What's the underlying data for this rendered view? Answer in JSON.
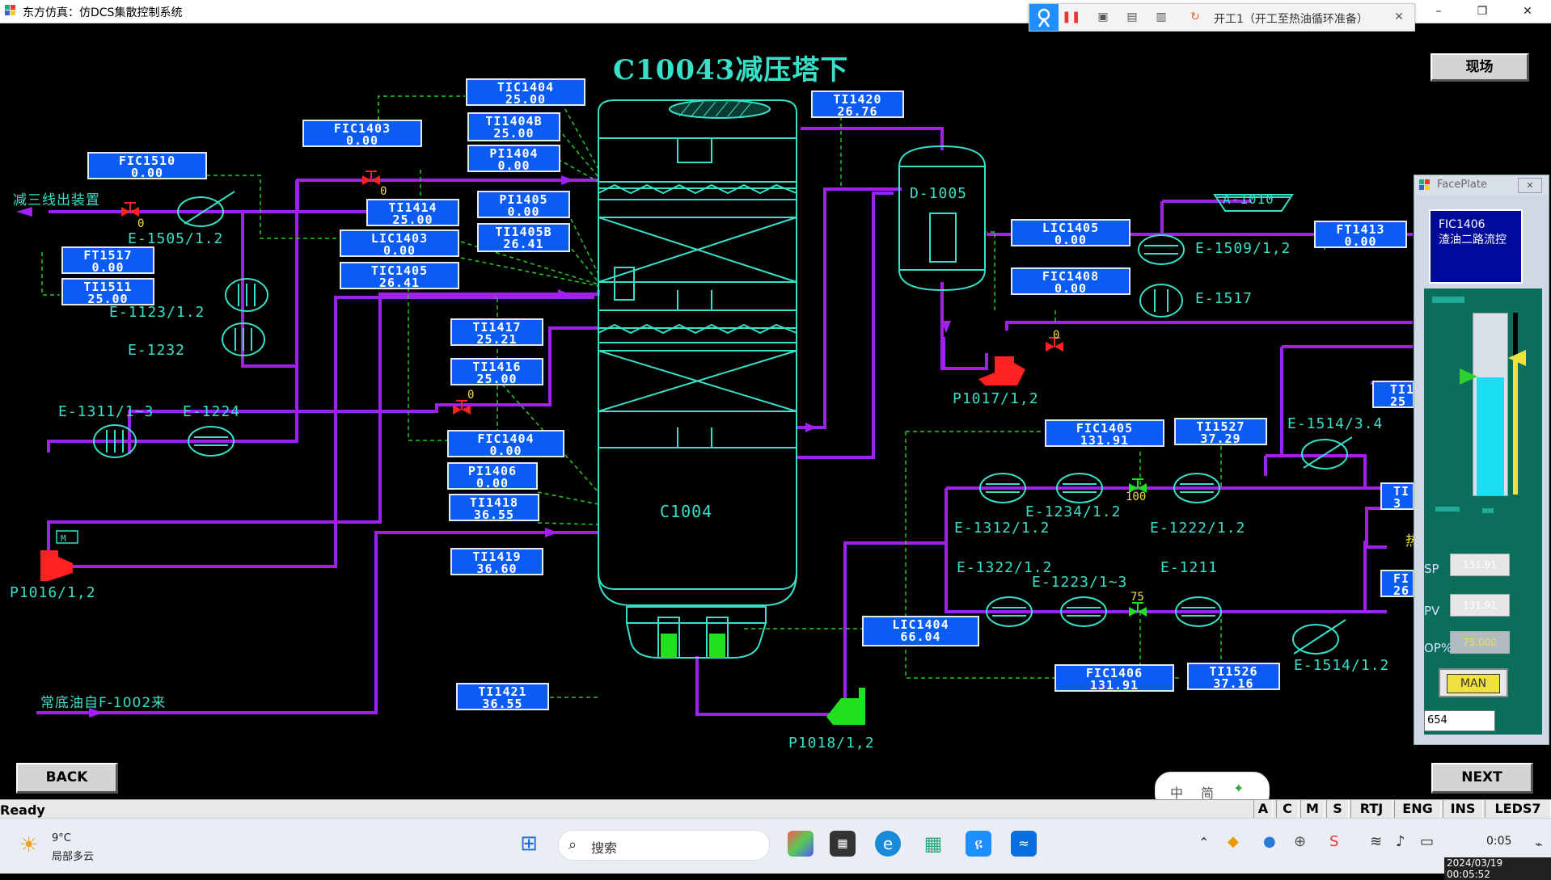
{
  "window": {
    "title": "东方仿真：仿DCS集散控制系统",
    "minimize": "–",
    "restore": "❐",
    "close": "✕"
  },
  "recorder": {
    "label": "开工1（开工至热油循环准备）",
    "close": "✕"
  },
  "screen": {
    "title": "C10043减压塔下",
    "field_button": "现场",
    "back_button": "BACK",
    "next_button": "NEXT"
  },
  "tags": [
    {
      "id": "TIC1404",
      "name": "TIC1404",
      "value": "25.00"
    },
    {
      "id": "TI1404B",
      "name": "TI1404B",
      "value": "25.00"
    },
    {
      "id": "PI1404",
      "name": "PI1404",
      "value": "0.00"
    },
    {
      "id": "TI1420",
      "name": "TI1420",
      "value": "26.76"
    },
    {
      "id": "FIC1403",
      "name": "FIC1403",
      "value": "0.00"
    },
    {
      "id": "FIC1510",
      "name": "FIC1510",
      "value": "0.00"
    },
    {
      "id": "TI1414",
      "name": "TI1414",
      "value": "25.00"
    },
    {
      "id": "PI1405",
      "name": "PI1405",
      "value": "0.00"
    },
    {
      "id": "LIC1403",
      "name": "LIC1403",
      "value": "0.00"
    },
    {
      "id": "TI1405B",
      "name": "TI1405B",
      "value": "26.41"
    },
    {
      "id": "TIC1405",
      "name": "TIC1405",
      "value": "26.41"
    },
    {
      "id": "FT1517",
      "name": "FT1517",
      "value": "0.00"
    },
    {
      "id": "TI1511",
      "name": "TI1511",
      "value": "25.00"
    },
    {
      "id": "TI1417",
      "name": "TI1417",
      "value": "25.21"
    },
    {
      "id": "TI1416",
      "name": "TI1416",
      "value": "25.00"
    },
    {
      "id": "FIC1404",
      "name": "FIC1404",
      "value": "0.00"
    },
    {
      "id": "PI1406",
      "name": "PI1406",
      "value": "0.00"
    },
    {
      "id": "TI1418",
      "name": "TI1418",
      "value": "36.55"
    },
    {
      "id": "TI1419",
      "name": "TI1419",
      "value": "36.60"
    },
    {
      "id": "TI1421",
      "name": "TI1421",
      "value": "36.55"
    },
    {
      "id": "LIC1405",
      "name": "LIC1405",
      "value": "0.00"
    },
    {
      "id": "FIC1408",
      "name": "FIC1408",
      "value": "0.00"
    },
    {
      "id": "FT1413",
      "name": "FT1413",
      "value": "0.00"
    },
    {
      "id": "FIC1405",
      "name": "FIC1405",
      "value": "131.91"
    },
    {
      "id": "TI1527",
      "name": "TI1527",
      "value": "37.29"
    },
    {
      "id": "LIC1404",
      "name": "LIC1404",
      "value": "66.04"
    },
    {
      "id": "FIC1406",
      "name": "FIC1406",
      "value": "131.91"
    },
    {
      "id": "TI1526",
      "name": "TI1526",
      "value": "37.16"
    },
    {
      "id": "TI_clip1",
      "name": "TI1",
      "value": "25"
    },
    {
      "id": "TI_clip2",
      "name": "TI",
      "value": "3"
    },
    {
      "id": "FI_clip3",
      "name": "FI",
      "value": "26"
    }
  ],
  "labels": {
    "out_line": "减三线出装置",
    "in_line": "常底油自F-1002来",
    "e1505": "E-1505/1.2",
    "e1123": "E-1123/1.2",
    "e1232": "E-1232",
    "e1311": "E-1311/1~3",
    "e1224": "E-1224",
    "p1016": "P1016/1,2",
    "p1018": "P1018/1,2",
    "p1017": "P1017/1,2",
    "c1004": "C1004",
    "d1005": "D-1005",
    "a1010": "A-1010",
    "e1509": "E-1509/1,2",
    "e1517": "E-1517",
    "e1514_34": "E-1514/3.4",
    "e1234": "E-1234/1.2",
    "e1312": "E-1312/1.2",
    "e1222": "E-1222/1.2",
    "e1322": "E-1322/1.2",
    "e1223": "E-1223/1~3",
    "e1211": "E-1211",
    "e1514_12": "E-1514/1.2",
    "motor": "M",
    "clip_char": "热"
  },
  "valves": {
    "v1": "0",
    "v2": "0",
    "v3": "0",
    "v4": "0",
    "v_1408": "0",
    "v_1405": "100",
    "v_1406": "75"
  },
  "faceplate": {
    "window_title": "FacePlate",
    "tag": "FIC1406",
    "desc": "渣油二路流控",
    "sp_label": "SP",
    "pv_label": "PV",
    "op_label": "OP%",
    "sp_value": "131.91",
    "pv_value": "131.91",
    "op_value": "75.000",
    "mode": "MAN",
    "input_value": "654",
    "pv_fraction": 0.65,
    "op_fraction": 0.75
  },
  "statusbar": {
    "ready": "Ready",
    "cells": [
      "A",
      "C",
      "M",
      "S",
      "RTJ",
      "ENG",
      "INS",
      "LEDS7"
    ]
  },
  "ime": {
    "zh": "中",
    "simp": "简"
  },
  "taskbar": {
    "weather_temp": "9°C",
    "weather_desc": "局部多云",
    "search": "搜索",
    "time": "0:05",
    "stamp": "2024/03/19 00:05:52"
  },
  "colors": {
    "pipe_purple": "#a020f0",
    "signal_green": "#28c828",
    "equipment_cyan": "#38e0c8",
    "tag_blue": "#0a5cf5",
    "valve_red": "#ff2020",
    "valve_green": "#20e020"
  }
}
